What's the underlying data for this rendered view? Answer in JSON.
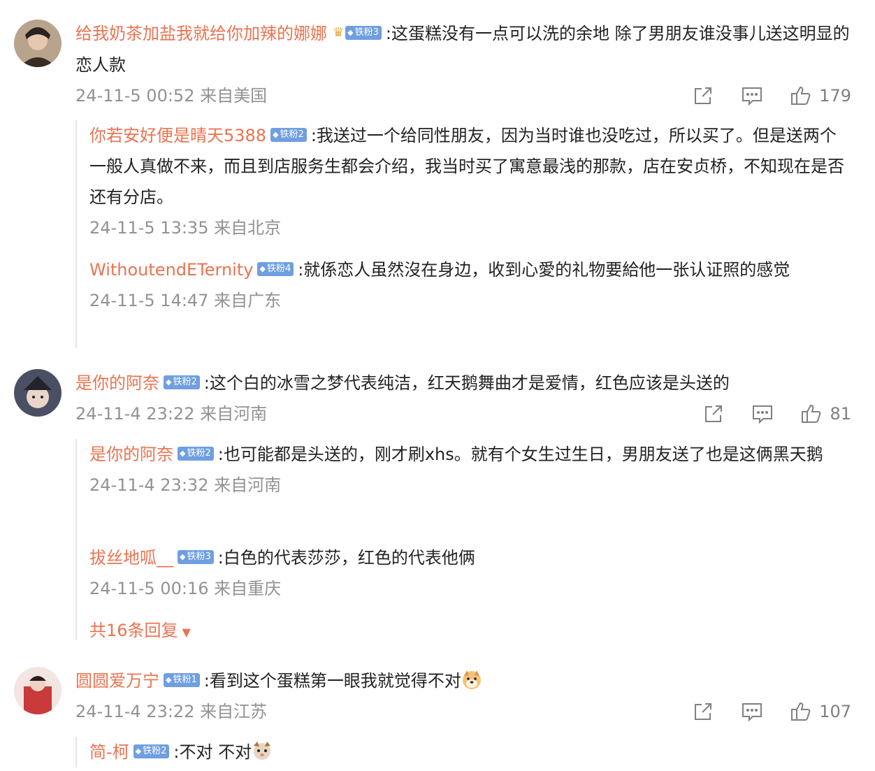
{
  "comments": [
    {
      "name": "给我奶茶加盐我就给你加辣的娜娜",
      "badge": "铁粉3",
      "text": ":这蛋糕没有一点可以洗的余地 除了男朋友谁没事儿送这明显的恋人款",
      "time": "24-11-5 00:52 来自美国",
      "likes": "179"
    },
    {
      "name": "是你的阿奈",
      "badge": "铁粉2",
      "text": ":这个白的冰雪之梦代表纯洁，红天鹅舞曲才是爱情，红色应该是头送的",
      "time": "24-11-4 23:22 来自河南",
      "likes": "81"
    },
    {
      "name": "圆圆爱万宁",
      "badge": "铁粉1",
      "text": ":看到这个蛋糕第一眼我就觉得不对",
      "time": "24-11-4 23:22 来自江苏",
      "likes": "107"
    }
  ],
  "replies1": [
    {
      "name": "你若安好便是晴天5388",
      "badge": "铁粉2",
      "text": ":我送过一个给同性朋友，因为当时谁也没吃过，所以买了。但是送两个一般人真做不来，而且到店服务生都会介绍，我当时买了寓意最浅的那款，店在安贞桥，不知现在是否还有分店。",
      "time": "24-11-5 13:35 来自北京"
    },
    {
      "name": "WithoutendETernity",
      "badge": "铁粉4",
      "text": ":就係恋人虽然沒在身边，收到心愛的礼物要給他一张认证照的感觉",
      "time": "24-11-5 14:47 来自广东"
    }
  ],
  "replies2": [
    {
      "name": "是你的阿奈",
      "badge": "铁粉2",
      "text": ":也可能都是头送的，刚才刷xhs。就有个女生过生日，男朋友送了也是这俩黑天鹅",
      "time": "24-11-4 23:32 来自河南"
    },
    {
      "name": "拔丝地呱__",
      "badge": "铁粉3",
      "text": ":白色的代表莎莎，红色的代表他俩",
      "time": "24-11-5 00:16 来自重庆"
    }
  ],
  "more_replies": "共16条回复",
  "replies3": [
    {
      "name": "简-柯",
      "badge": "铁粉2",
      "text": ":不对 不对"
    }
  ],
  "colors": {
    "name": "#eb7350",
    "badge": "#6f9fe0",
    "meta": "#929292"
  },
  "icons": [
    "share-icon",
    "comment-icon",
    "like-icon",
    "crown-icon",
    "dog-emoji-icon",
    "cat-emoji-icon"
  ]
}
